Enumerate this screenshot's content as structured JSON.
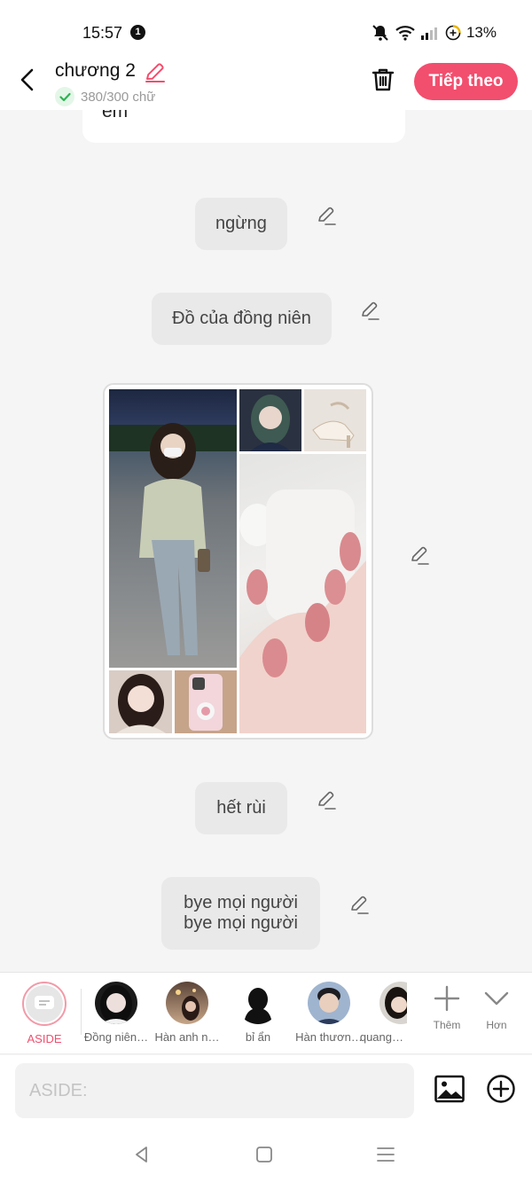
{
  "status_bar": {
    "time": "15:57",
    "notification_count": "1",
    "battery": "13%"
  },
  "header": {
    "title": "chương 2",
    "word_count": "380/300 chữ",
    "next_label": "Tiếp theo"
  },
  "messages": {
    "previous_text": "em",
    "items": [
      {
        "lines": [
          "ngừng"
        ]
      },
      {
        "lines": [
          "Đồ của đồng niên"
        ]
      },
      {
        "lines": [
          "hết rùi"
        ]
      },
      {
        "lines": [
          "bye mọi người",
          "bye mọi người"
        ]
      }
    ]
  },
  "characters": [
    {
      "name": "ASIDE"
    },
    {
      "name": "Đồng niên…"
    },
    {
      "name": "Hàn anh n…"
    },
    {
      "name": "bỉ ẩn"
    },
    {
      "name": "Hàn thươn…"
    },
    {
      "name": "quang…"
    }
  ],
  "tools": {
    "more_label": "Thêm",
    "expand_label": "Hơn"
  },
  "composer": {
    "placeholder": "ASIDE:"
  },
  "colors": {
    "accent": "#f24e6e",
    "bubble": "#e9e9e9",
    "background": "#f5f5f5"
  }
}
